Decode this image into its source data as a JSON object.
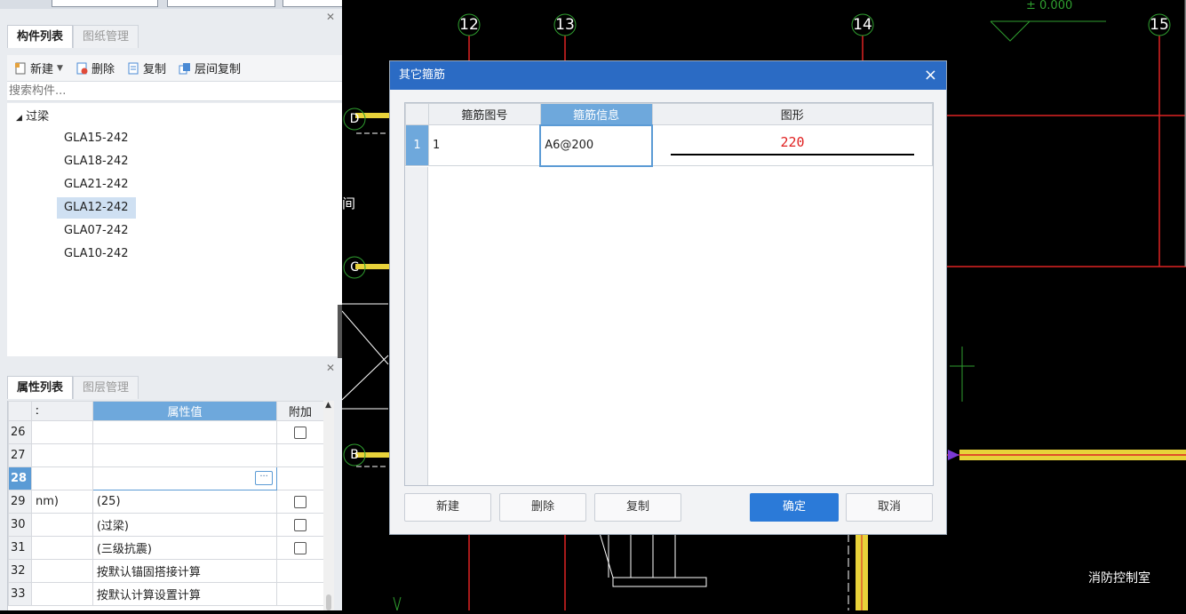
{
  "left_panel": {
    "top_tabs": [
      "构件列表",
      "图纸管理"
    ],
    "toolbar": {
      "new": "新建",
      "delete": "删除",
      "copy": "复制",
      "floor_copy": "层间复制",
      "more": "»"
    },
    "search_placeholder": "搜索构件...",
    "tree": {
      "root": "过梁",
      "items": [
        "GLA15-242",
        "GLA18-242",
        "GLA21-242",
        "GLA12-242",
        "GLA07-242",
        "GLA10-242"
      ],
      "selected": "GLA12-242"
    },
    "bottom_tabs": [
      "属性列表",
      "图层管理"
    ],
    "grid": {
      "headers": {
        "name": "ː",
        "value": "属性值",
        "extra": "附加"
      },
      "rows": [
        {
          "num": "26",
          "name": "",
          "value": ""
        },
        {
          "num": "27",
          "name": "",
          "value": ""
        },
        {
          "num": "28",
          "name": "",
          "value": ""
        },
        {
          "num": "29",
          "name": "nm)",
          "value": "(25)"
        },
        {
          "num": "30",
          "name": "",
          "value": "(过梁)"
        },
        {
          "num": "31",
          "name": "",
          "value": "(三级抗震)"
        },
        {
          "num": "32",
          "name": "",
          "value": "按默认锚固搭接计算"
        },
        {
          "num": "33",
          "name": "",
          "value": "按默认计算设置计算"
        }
      ]
    }
  },
  "cad": {
    "axis_labels": [
      "12",
      "13",
      "14",
      "15",
      "D",
      "C",
      "B"
    ],
    "elevation_text": "± 0.000",
    "room_label": "消防控制室",
    "edge_glyph": "间"
  },
  "dialog": {
    "title": "其它箍筋",
    "columns": [
      "箍筋图号",
      "箍筋信息",
      "图形"
    ],
    "rows": [
      {
        "index": "1",
        "figure_no": "1",
        "info": "A6@200",
        "shape_value": "220"
      }
    ],
    "buttons": {
      "new": "新建",
      "delete": "删除",
      "copy": "复制",
      "ok": "确定",
      "cancel": "取消"
    }
  }
}
